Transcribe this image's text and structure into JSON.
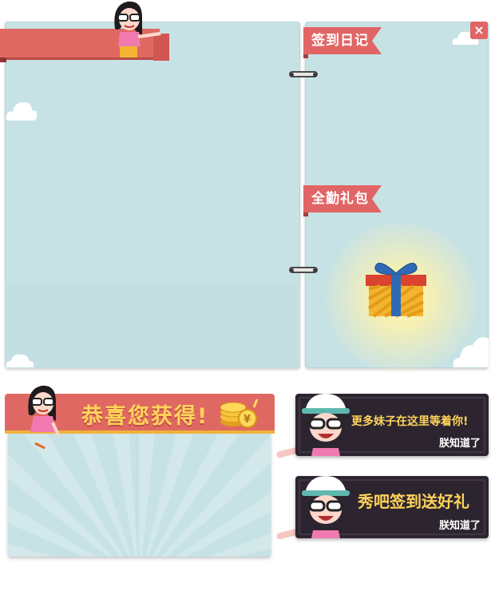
{
  "window": {
    "close_label": "×"
  },
  "right_page": {
    "diary_label": "签到日记",
    "gift_label": "全勤礼包"
  },
  "reward": {
    "title": "恭喜您获得!"
  },
  "cards": [
    {
      "message": "更多妹子在这里等着你!",
      "ok_label": "朕知道了"
    },
    {
      "message": "秀吧签到送好礼",
      "ok_label": "朕知道了"
    }
  ],
  "colors": {
    "ribbon": "#e26565",
    "panel": "#c7e2e4",
    "gold": "#ffd35a",
    "card": "#2c2530"
  },
  "icons": [
    "close-icon",
    "gift-icon",
    "coins-icon",
    "cloud-icon",
    "binder-ring-icon"
  ]
}
